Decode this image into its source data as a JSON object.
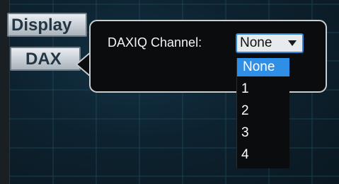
{
  "side_buttons": {
    "display_label": "Display",
    "dax_label": "DAX"
  },
  "popup": {
    "channel_label": "DAXIQ Channel:",
    "selected_value": "None",
    "options": [
      "None",
      "1",
      "2",
      "3",
      "4"
    ],
    "highlighted_option": "None"
  },
  "colors": {
    "background": "#0d2230",
    "gridline": "#1f4a5f",
    "popup_background": "#0a0c0e",
    "popup_border": "#c8cdd2",
    "highlight": "#2f8fe6",
    "select_focus_border": "#2f86d8"
  },
  "icons": {
    "dropdown_arrow": "chevron-down-icon"
  }
}
